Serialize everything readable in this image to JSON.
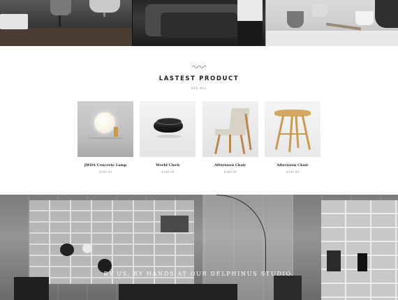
{
  "section": {
    "title": "LASTEST PRODUCT",
    "see_all": "SEE ALL"
  },
  "products": [
    {
      "name": "JWDA Concrete Lamp",
      "price": "$340.00"
    },
    {
      "name": "World Clock",
      "price": "$340.00"
    },
    {
      "name": "Afternoon Chair",
      "price": "$340.00"
    },
    {
      "name": "Afternoon Chair",
      "price": "$340.00"
    }
  ],
  "studio": {
    "caption": "BY US, BY HANDS AT OUR DELPHINUS STUDIO."
  },
  "colors": {
    "title": "#1d1d1d",
    "price": "#999999",
    "caption": "#ffffff"
  }
}
